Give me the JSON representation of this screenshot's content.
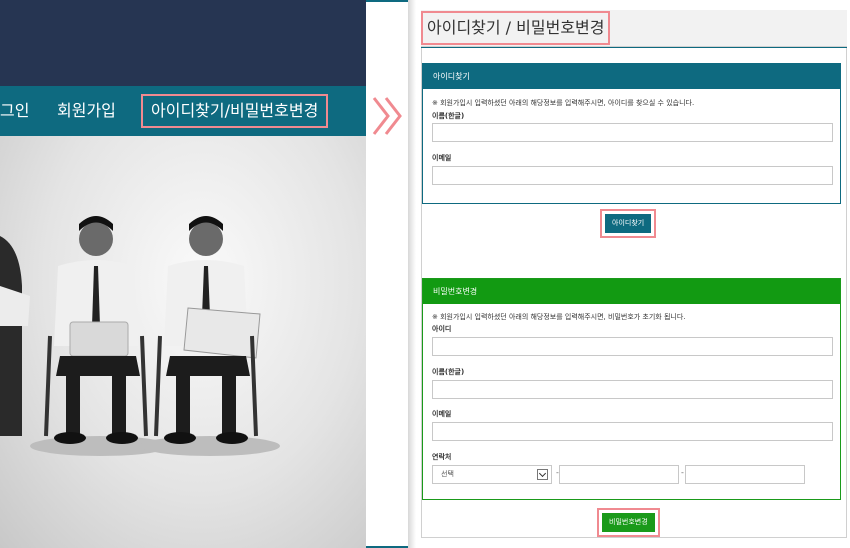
{
  "left_nav": {
    "login": "그인",
    "join": "회원가입",
    "find": "아이디찾기/비밀번호변경"
  },
  "page_title": "아이디찾기 / 비밀번호변경",
  "find_id": {
    "header": "아이디찾기",
    "notice": "※ 회원가입시 입력하셨던 아래의 해당정보를 입력해주시면, 아이디를 찾으실 수 있습니다.",
    "name_label": "이름(한글)",
    "email_label": "이메일",
    "button": "아이디찾기"
  },
  "reset_pw": {
    "header": "비밀번호변경",
    "notice": "※ 회원가입시 입력하셨던 아래의 해당정보를 입력해주시면, 비밀번호가 초기화 됩니다.",
    "id_label": "아이디",
    "name_label": "이름(한글)",
    "email_label": "이메일",
    "phone_label": "연락처",
    "phone_select": "선택",
    "phone_sep": "-",
    "button": "비밀번호변경"
  },
  "colors": {
    "nav_bg": "#0e6a80",
    "top_bg": "#263552",
    "green": "#1a9a1a",
    "highlight": "#f08a90"
  },
  "icons": [
    "double-chevron-right-icon",
    "chevron-down-icon"
  ]
}
